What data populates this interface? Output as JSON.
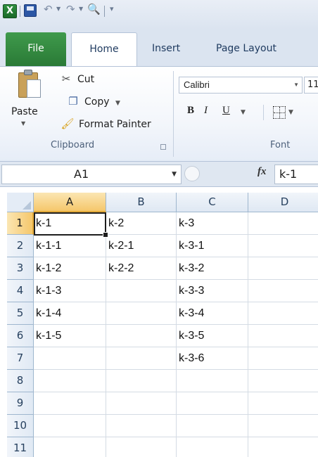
{
  "quick_access": {
    "undo_icon": "undo-icon",
    "redo_icon": "redo-icon",
    "print_preview_icon": "print-preview-icon"
  },
  "tabs": [
    {
      "label": "File"
    },
    {
      "label": "Home"
    },
    {
      "label": "Insert"
    },
    {
      "label": "Page Layout"
    }
  ],
  "ribbon": {
    "clipboard": {
      "paste_label": "Paste",
      "cut_label": "Cut",
      "copy_label": "Copy",
      "format_painter_label": "Format Painter",
      "group_label": "Clipboard"
    },
    "font": {
      "font_name": "Calibri",
      "font_size": "11",
      "bold": "B",
      "italic": "I",
      "underline": "U",
      "group_label": "Font"
    }
  },
  "formula_bar": {
    "name_box": "A1",
    "fx_label": "fx",
    "formula": "k-1"
  },
  "sheet": {
    "columns": [
      "A",
      "B",
      "C",
      "D"
    ],
    "rows": [
      {
        "num": "1",
        "cells": [
          "k-1",
          "k-2",
          "k-3",
          ""
        ]
      },
      {
        "num": "2",
        "cells": [
          "k-1-1",
          "k-2-1",
          "k-3-1",
          ""
        ]
      },
      {
        "num": "3",
        "cells": [
          "k-1-2",
          "k-2-2",
          "k-3-2",
          ""
        ]
      },
      {
        "num": "4",
        "cells": [
          "k-1-3",
          "",
          "k-3-3",
          ""
        ]
      },
      {
        "num": "5",
        "cells": [
          "k-1-4",
          "",
          "k-3-4",
          ""
        ]
      },
      {
        "num": "6",
        "cells": [
          "k-1-5",
          "",
          "k-3-5",
          ""
        ]
      },
      {
        "num": "7",
        "cells": [
          "",
          "",
          "k-3-6",
          ""
        ]
      },
      {
        "num": "8",
        "cells": [
          "",
          "",
          "",
          ""
        ]
      },
      {
        "num": "9",
        "cells": [
          "",
          "",
          "",
          ""
        ]
      },
      {
        "num": "10",
        "cells": [
          "",
          "",
          "",
          ""
        ]
      },
      {
        "num": "11",
        "cells": [
          "",
          "",
          "",
          ""
        ]
      }
    ],
    "selected_cell": "A1"
  },
  "colors": {
    "file_tab": "#2a7a36",
    "selected_header": "#f5c76b",
    "header_blue": "#dfe8f3"
  }
}
